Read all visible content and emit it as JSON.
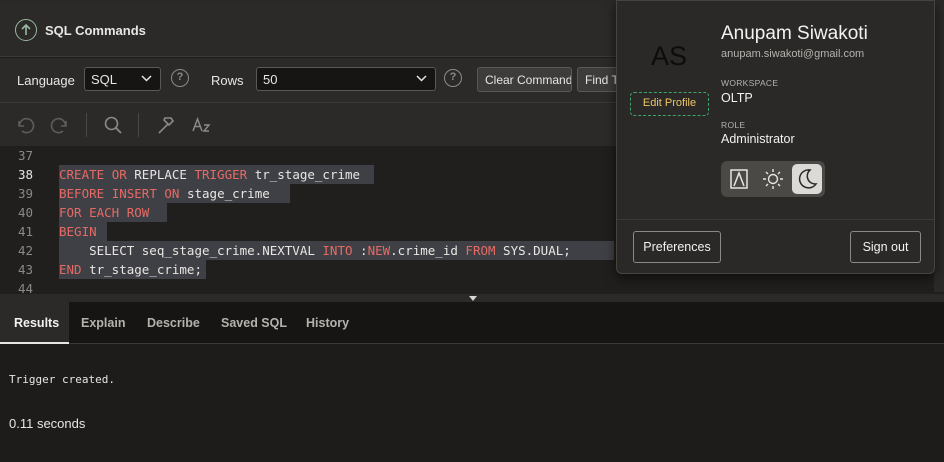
{
  "header": {
    "title": "SQL Commands"
  },
  "options": {
    "language_label": "Language",
    "language_value": "SQL",
    "rows_label": "Rows",
    "rows_value": "50",
    "help_glyph": "?",
    "clear_command": "Clear Command",
    "find_tables": "Find T"
  },
  "toolbar": {
    "icons": [
      "undo-icon",
      "redo-icon",
      "search-icon",
      "hammer-icon",
      "text-case-icon"
    ]
  },
  "editor": {
    "lines": [
      {
        "num": "37",
        "parts": []
      },
      {
        "num": "38",
        "parts": [
          [
            "kw",
            "CREATE"
          ],
          [
            "t",
            " "
          ],
          [
            "kw",
            "OR"
          ],
          [
            "t",
            " REPLACE "
          ],
          [
            "kw",
            "TRIGGER"
          ],
          [
            "t",
            " tr_stage_crime"
          ]
        ]
      },
      {
        "num": "39",
        "parts": [
          [
            "kw",
            "BEFORE"
          ],
          [
            "t",
            " "
          ],
          [
            "kw",
            "INSERT"
          ],
          [
            "t",
            " "
          ],
          [
            "kw",
            "ON"
          ],
          [
            "t",
            " stage_crime"
          ]
        ]
      },
      {
        "num": "40",
        "parts": [
          [
            "kw",
            "FOR EACH ROW"
          ]
        ]
      },
      {
        "num": "41",
        "parts": [
          [
            "kw",
            "BEGIN"
          ]
        ]
      },
      {
        "num": "42",
        "parts": [
          [
            "t",
            "    SELECT seq_stage_crime.NEXTVAL "
          ],
          [
            "kw",
            "INTO"
          ],
          [
            "t",
            " :"
          ],
          [
            "kw",
            "NEW"
          ],
          [
            "t",
            ".crime_id "
          ],
          [
            "kw",
            "FROM"
          ],
          [
            "t",
            " SYS.DUAL;"
          ]
        ]
      },
      {
        "num": "43",
        "parts": [
          [
            "kw",
            "END"
          ],
          [
            "t",
            " tr_stage_crime;"
          ]
        ]
      },
      {
        "num": "44",
        "parts": []
      }
    ],
    "current_line": "38"
  },
  "results": {
    "tabs": [
      "Results",
      "Explain",
      "Describe",
      "Saved SQL",
      "History"
    ],
    "active_tab": "Results",
    "message": "Trigger created.",
    "timing": "0.11 seconds"
  },
  "profile": {
    "initials": "AS",
    "edit_profile": "Edit Profile",
    "name": "Anupam Siwakoti",
    "email": "anupam.siwakoti@gmail.com",
    "workspace_label": "WORKSPACE",
    "workspace": "OLTP",
    "role_label": "ROLE",
    "role": "Administrator",
    "theme_options": [
      "contrast-icon",
      "sun-icon",
      "moon-icon"
    ],
    "theme_selected": "moon-icon",
    "preferences": "Preferences",
    "sign_out": "Sign out"
  },
  "colors": {
    "keyword": "#e66a64",
    "background": "#1d1c1b",
    "panel": "#2b2a28",
    "edit_profile_text": "#f0c565",
    "edit_profile_border": "#3fa46a"
  }
}
